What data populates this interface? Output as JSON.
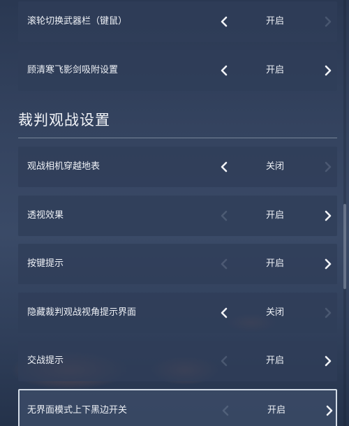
{
  "sections": [
    {
      "title": "",
      "rows": [
        {
          "label": "滚轮切换武器栏（键鼠）",
          "value": "开启",
          "left_enabled": true,
          "right_enabled": false
        },
        {
          "label": "顾清寒飞影剑吸附设置",
          "value": "开启",
          "left_enabled": true,
          "right_enabled": true
        }
      ]
    },
    {
      "title": "裁判观战设置",
      "rows": [
        {
          "label": "观战相机穿越地表",
          "value": "关闭",
          "left_enabled": true,
          "right_enabled": false
        },
        {
          "label": "透视效果",
          "value": "开启",
          "left_enabled": false,
          "right_enabled": true
        },
        {
          "label": "按键提示",
          "value": "开启",
          "left_enabled": false,
          "right_enabled": true
        },
        {
          "label": "隐藏裁判观战视角提示界面",
          "value": "关闭",
          "left_enabled": true,
          "right_enabled": false
        },
        {
          "label": "交战提示",
          "value": "开启",
          "left_enabled": false,
          "right_enabled": true
        },
        {
          "label": "无界面模式上下黑边开关",
          "value": "开启",
          "left_enabled": false,
          "right_enabled": true,
          "selected": true
        }
      ]
    }
  ],
  "icons": {
    "left": "chevron-left-icon",
    "right": "chevron-right-icon"
  }
}
